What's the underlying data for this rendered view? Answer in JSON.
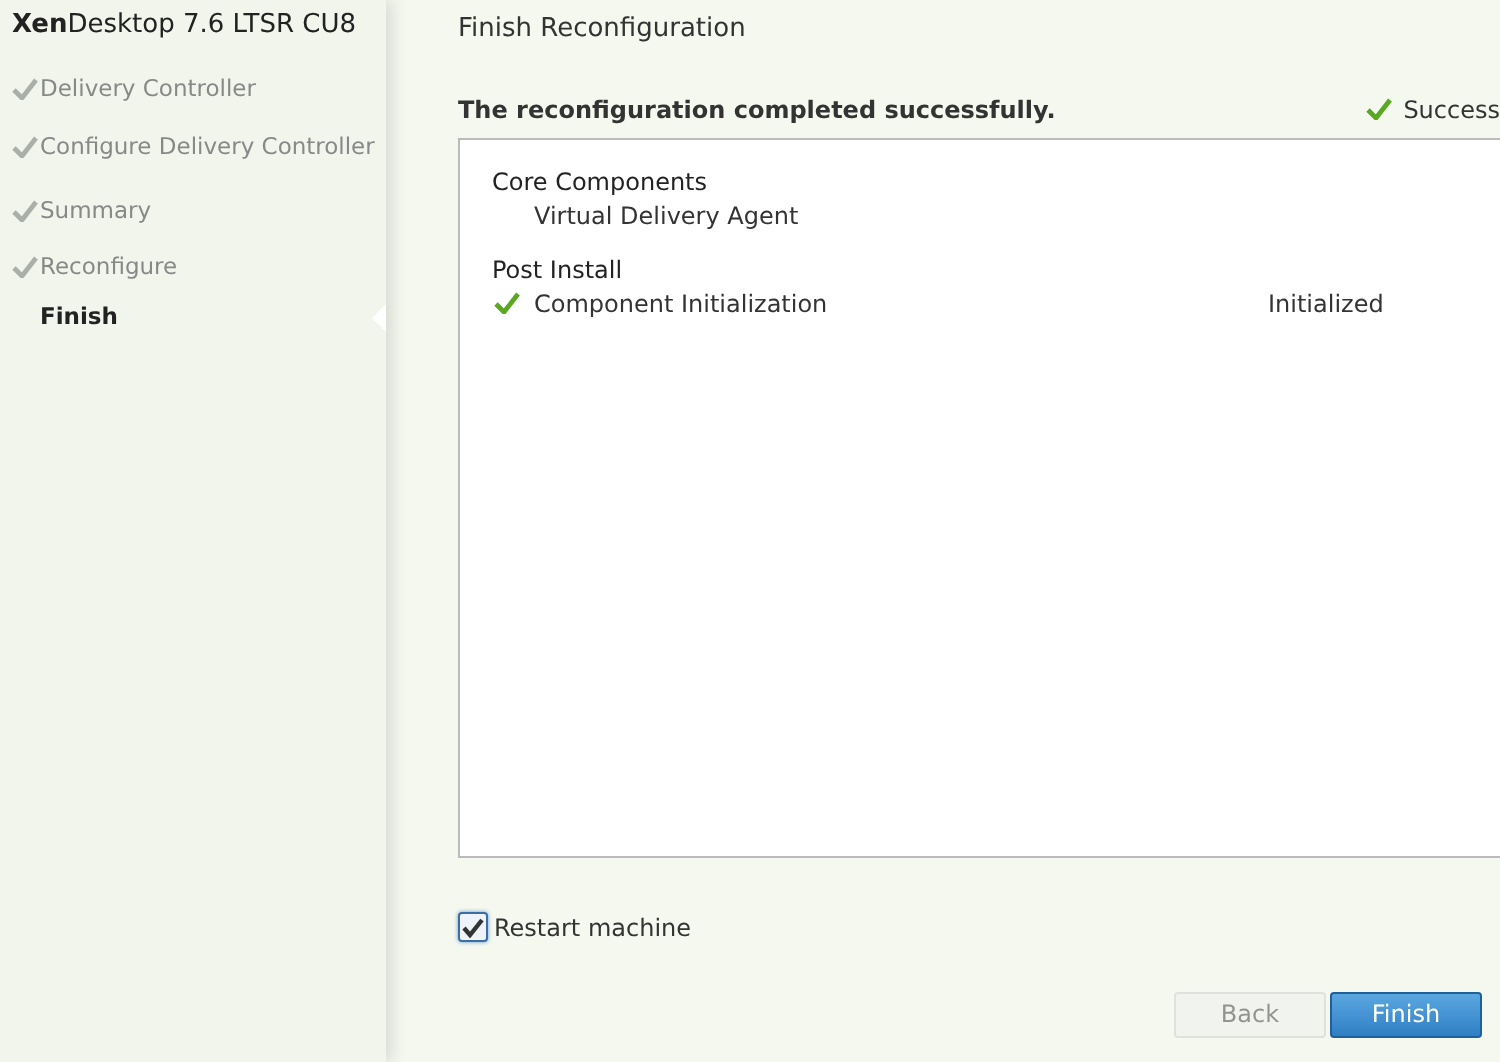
{
  "product_title": "**Xen**Desktop 7.6 LTSR CU8",
  "steps": [
    {
      "label": "Delivery Controller",
      "done": true,
      "selected": false
    },
    {
      "label": "Configure Delivery Controller",
      "done": true,
      "selected": false
    },
    {
      "label": "Summary",
      "done": true,
      "selected": false
    },
    {
      "label": "Reconfigure",
      "done": true,
      "selected": false
    },
    {
      "label": "Finish",
      "done": false,
      "selected": true
    }
  ],
  "page_title": "Finish Reconfiguration",
  "message": "The reconfiguration completed successfully.",
  "status": {
    "label": "Success",
    "ok": true
  },
  "groups": [
    {
      "heading": "Core Components",
      "items": [
        {
          "name": "Virtual Delivery Agent",
          "ok": false
        }
      ]
    },
    {
      "heading": "Post Install",
      "items": [
        {
          "name": "Component Initialization",
          "ok": true,
          "status": "Initialized"
        }
      ]
    }
  ],
  "restart": {
    "label": "Restart machine",
    "checked": true
  },
  "buttons": [
    {
      "label": "Back",
      "disabled": true,
      "primary": false
    },
    {
      "label": "Finish",
      "disabled": false,
      "primary": true
    }
  ]
}
